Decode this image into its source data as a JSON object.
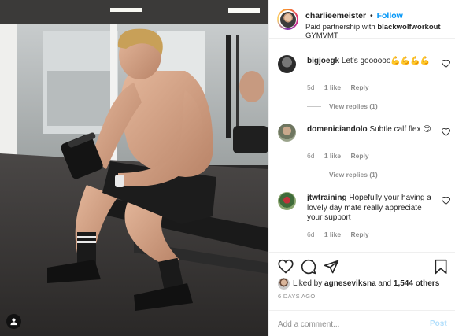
{
  "post": {
    "author": "charlieemeister",
    "separator": "•",
    "follow_label": "Follow",
    "partnership_prefix": "Paid partnership with",
    "partner": "blackwolfworkout",
    "location": "GYMVMT"
  },
  "comments": [
    {
      "username": "bigjoegk",
      "text": "Let's goooooo💪💪💪💪",
      "age": "5d",
      "likes": "1 like",
      "reply_label": "Reply",
      "view_replies": "View replies (1)"
    },
    {
      "username": "domeniciandolo",
      "text": "Subtle calf flex 😏",
      "age": "6d",
      "likes": "1 like",
      "reply_label": "Reply",
      "view_replies": "View replies (1)"
    },
    {
      "username": "jtwtraining",
      "text": "Hopefully your having a lovely day mate really appreciate your support",
      "age": "6d",
      "likes": "1 like",
      "reply_label": "Reply"
    }
  ],
  "likes": {
    "prefix": "Liked by",
    "liker": "agneseviksna",
    "joiner": "and",
    "others": "1,544 others"
  },
  "timestamp": "6 DAYS AGO",
  "comment_box": {
    "placeholder": "Add a comment...",
    "post_label": "Post"
  },
  "icons": {
    "like": "heart-icon",
    "comment": "comment-icon",
    "share": "share-icon",
    "save": "bookmark-icon",
    "tags": "user-tag-icon"
  },
  "colors": {
    "link": "#0095f6",
    "muted": "#8e8e8e",
    "post_disabled": "#b2dffc",
    "text": "#262626"
  }
}
